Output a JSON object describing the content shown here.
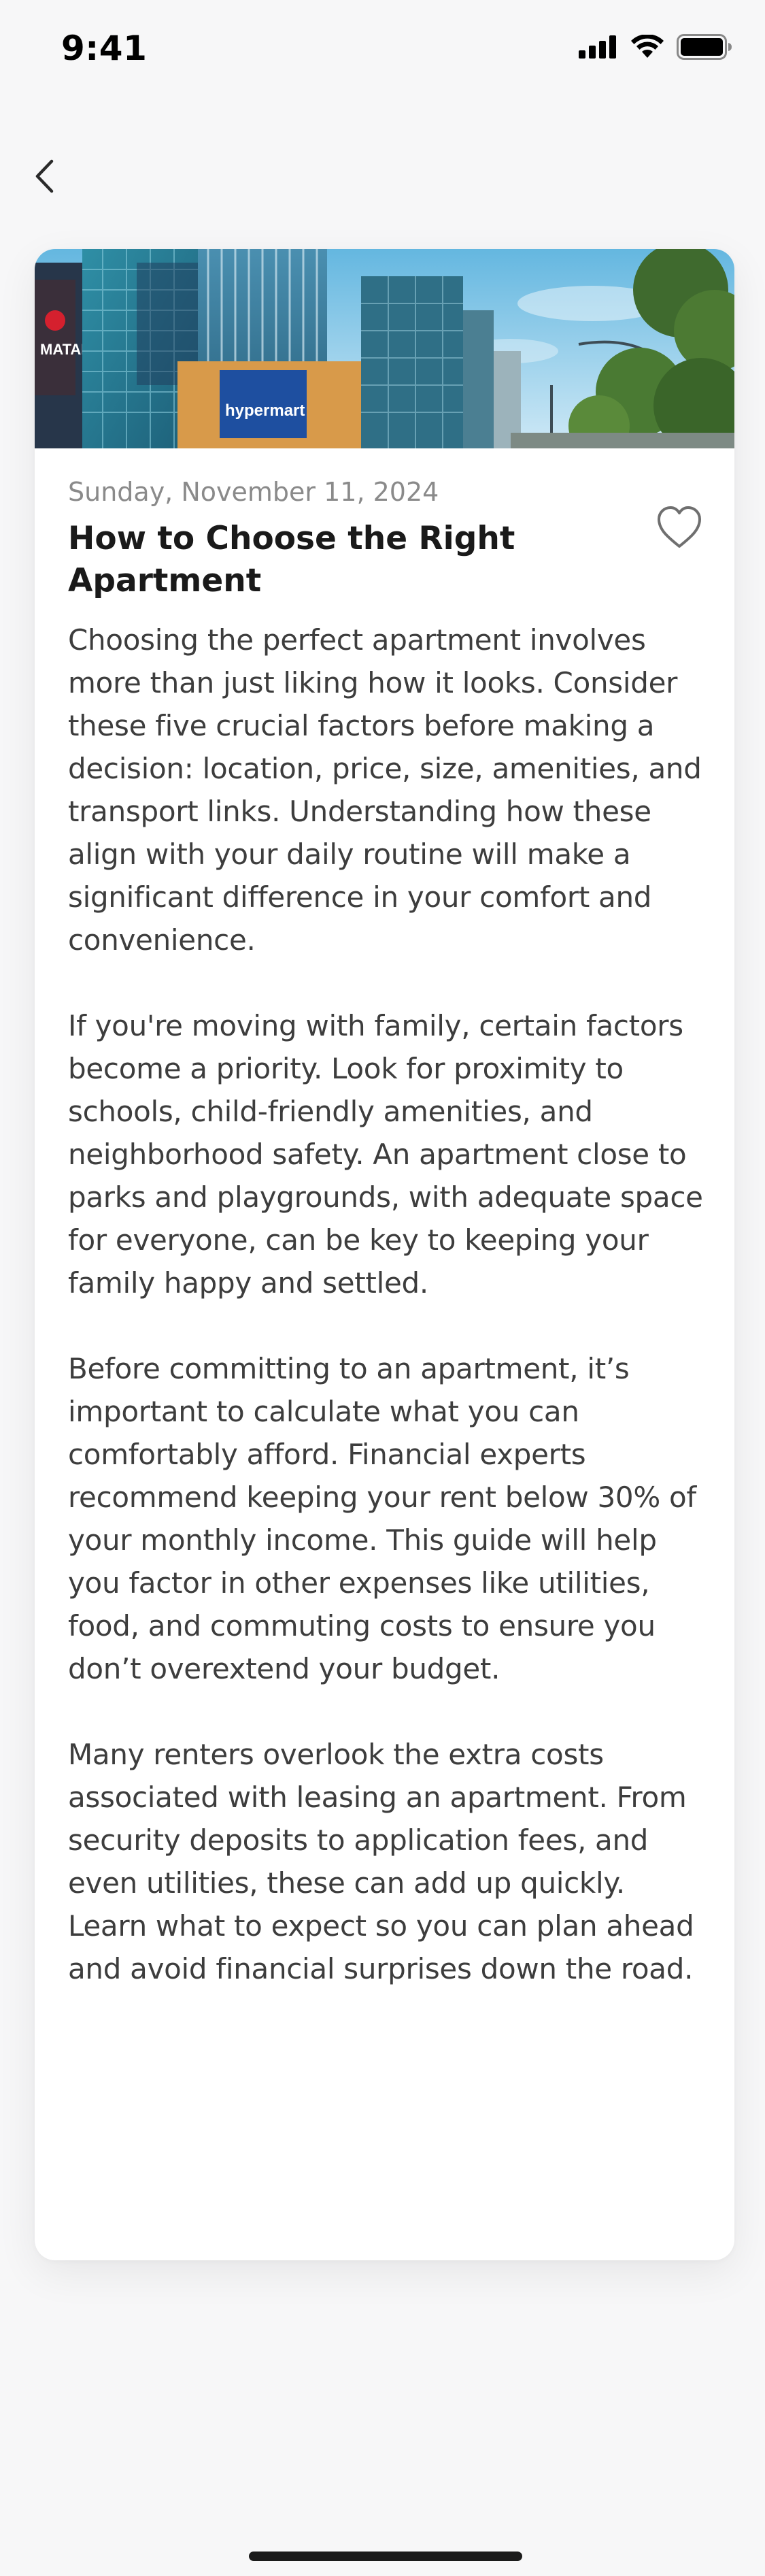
{
  "status_bar": {
    "time": "9:41",
    "icons": [
      "signal-icon",
      "wifi-icon",
      "battery-icon"
    ]
  },
  "navigation": {
    "back_icon": "chevron-left-icon"
  },
  "article": {
    "image_icon": "building-photo",
    "date": "Sunday, November 11, 2024",
    "favorite_icon": "heart-outline-icon",
    "title": "How to Choose the Right Apartment",
    "paragraphs": [
      "Choosing the perfect apartment involves more than just liking how it looks. Consider these five crucial factors before making a decision: location, price, size, amenities, and transport links. Understanding how these align with your daily routine will make a significant difference in your comfort and convenience.",
      "If you're moving with family, certain factors become a priority. Look for proximity to schools, child-friendly amenities, and neighborhood safety. An apartment close to parks and playgrounds, with adequate space for everyone, can be key to keeping your family happy and settled.",
      "Before committing to an apartment, it’s important to calculate what you can comfortably afford. Financial experts recommend keeping your rent below 30% of your monthly income. This guide will help you factor in other expenses like utilities, food, and commuting costs to ensure you don’t overextend your budget.",
      "Many renters overlook the extra costs associated with leasing an apartment. From security deposits to application fees, and even utilities, these can add up quickly. Learn what to expect so you can plan ahead and avoid financial surprises down the road."
    ],
    "image_signage": {
      "store_left": "MATAHARI",
      "store_center": "hypermart"
    }
  },
  "colors": {
    "background": "#f7f7f8",
    "card": "#ffffff",
    "title": "#1a1a1a",
    "body_text": "#3d3d3d",
    "date": "#8a8a8a",
    "icon": "#6f6f6f"
  }
}
